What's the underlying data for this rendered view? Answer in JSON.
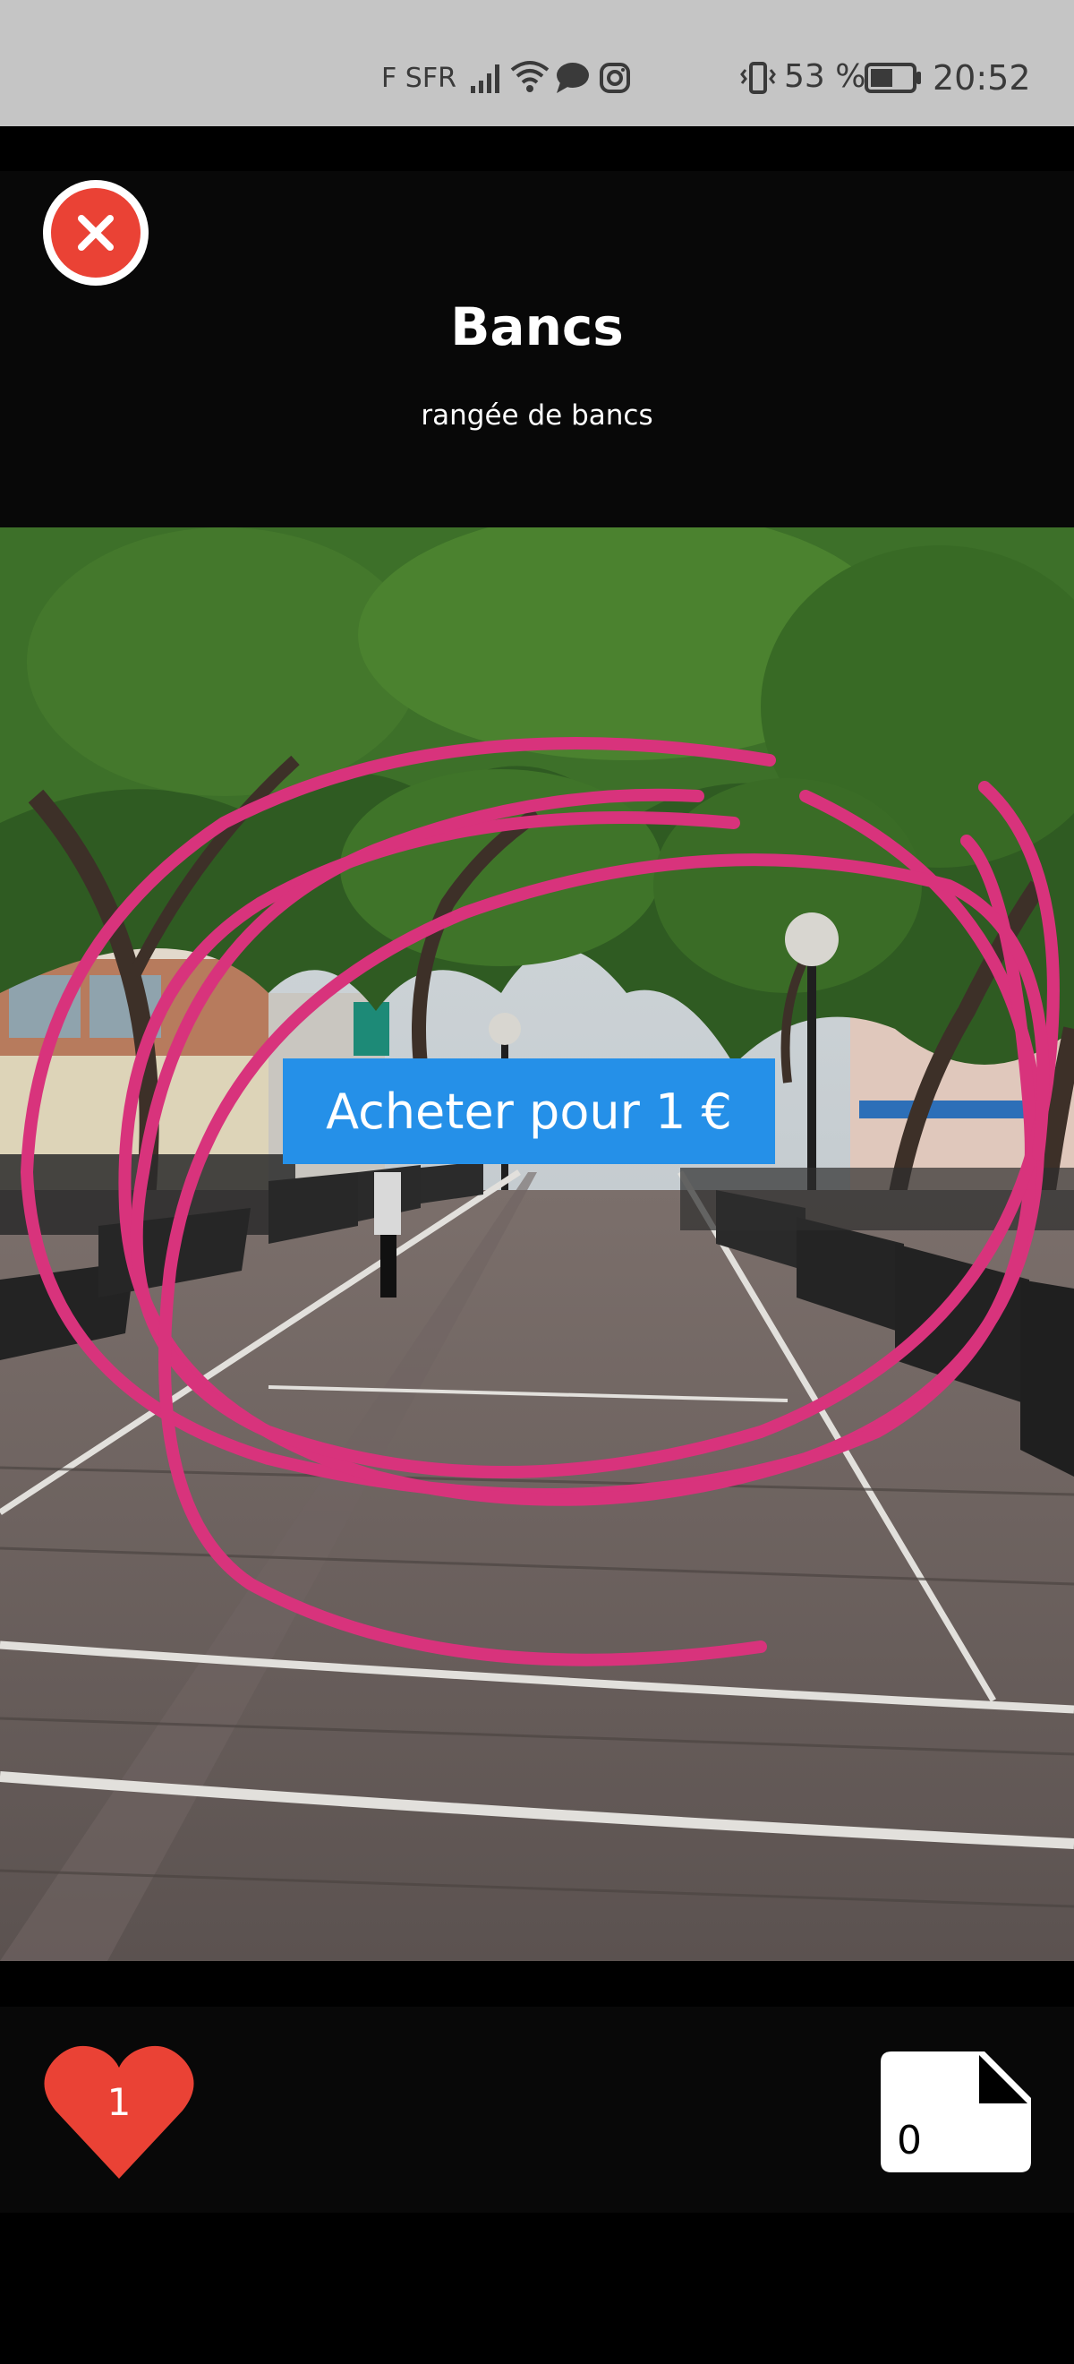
{
  "status_bar": {
    "carrier": "F SFR",
    "battery_percent": "53 %",
    "time": "20:52",
    "icons": [
      "signal-icon",
      "wifi-icon",
      "chat-icon",
      "instagram-icon",
      "vibrate-icon",
      "battery-icon"
    ]
  },
  "header": {
    "title": "Bancs",
    "subtitle": "rangée de bancs",
    "close_icon": "close-icon"
  },
  "photo": {
    "buy_label": "Acheter pour 1 €"
  },
  "bottom_bar": {
    "like_count": "1",
    "document_count": "0",
    "like_icon": "heart-icon",
    "document_icon": "document-icon"
  },
  "colors": {
    "close": "#ea4235",
    "heart": "#ea4235",
    "buy_button": "#2590e8",
    "scribble": "#d8337c"
  }
}
